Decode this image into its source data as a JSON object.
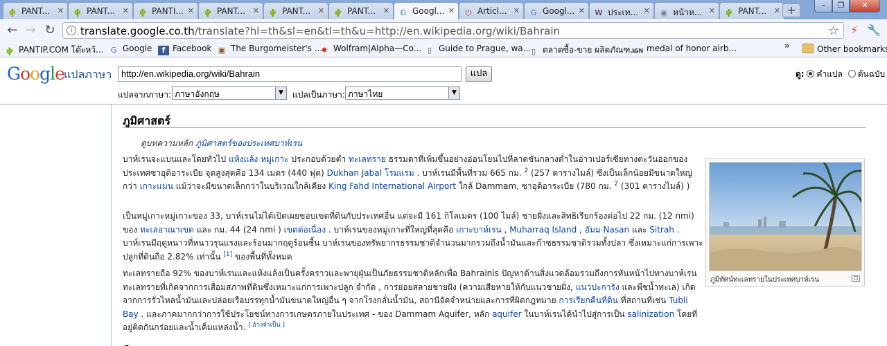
{
  "tabs": [
    {
      "label": "PANT...",
      "icon": "cactus-icon",
      "active": false
    },
    {
      "label": "PANT...",
      "icon": "cactus-icon",
      "active": false
    },
    {
      "label": "PANTI...",
      "icon": "cactus-icon",
      "active": false
    },
    {
      "label": "PANT...",
      "icon": "cactus-icon",
      "active": false
    },
    {
      "label": "PANT...",
      "icon": "cactus-icon",
      "active": false
    },
    {
      "label": "PANT...",
      "icon": "cactus-icon",
      "active": false
    },
    {
      "label": "Googl...",
      "icon": "google-translate-icon",
      "active": true
    },
    {
      "label": "Articl...",
      "icon": "power-icon",
      "active": false
    },
    {
      "label": "Googl...",
      "icon": "google-translate-icon",
      "active": false
    },
    {
      "label": "ประเท...",
      "icon": "wikipedia-icon",
      "active": false
    },
    {
      "label": "หน้าห...",
      "icon": "globe-icon",
      "active": false
    },
    {
      "label": "PANT...",
      "icon": "cactus-icon",
      "active": false
    }
  ],
  "toolbar": {
    "url_host": "translate.google.co.th",
    "url_rest": "/translate?hl=th&sl=en&tl=th&u=http://en.wikipedia.org/wiki/Bahrain"
  },
  "bookmarks": [
    {
      "label": "PANTIP.COM โต๊ะหว้...",
      "icon": "cactus-icon"
    },
    {
      "label": "Google",
      "icon": "google-icon"
    },
    {
      "label": "Facebook",
      "icon": "facebook-icon"
    },
    {
      "label": "The Burgomeister's ...",
      "icon": "burgomeister-icon"
    },
    {
      "label": "Wolfram|Alpha—Co...",
      "icon": "wolfram-icon"
    },
    {
      "label": "Guide to Prague, wa...",
      "icon": "page-icon"
    },
    {
      "label": "ตลาดซื้อ-ขาย ผลิตภัณฑ...",
      "icon": "page-icon"
    },
    {
      "label": "medal of honor airb...",
      "icon": "ign-icon"
    }
  ],
  "other_bookmarks": "Other bookmarks",
  "translate": {
    "logo_letters": [
      "G",
      "o",
      "o",
      "g",
      "l",
      "e"
    ],
    "product": "แปลภาษา",
    "url_value": "http://en.wikipedia.org/wiki/Bahrain",
    "go_label": "แปล",
    "from_label": "แปลจากภาษา:",
    "from_value": "ภาษาอังกฤษ",
    "to_label": "แปลเป็นภาษา:",
    "to_value": "ภาษาไทย",
    "view_label": "ดู:",
    "view_translation": "คำแปล",
    "view_original": "ต้นฉบับ"
  },
  "article": {
    "section_title": "ภูมิศาสตร์",
    "main_article_prefix": "ดูบทความหลัก",
    "main_article_link": "ภูมิศาสตร์ของประเทศบาห์เรน",
    "p1": [
      {
        "t": "บาห์เรนจะแบนและโดยทั่วไป "
      },
      {
        "a": "แห้งแล้ง หมู่เกาะ"
      },
      {
        "t": " ประกอบด้วยต่ำ "
      },
      {
        "a": "ทะเลทราย"
      },
      {
        "t": " ธรรมดาที่เพิ่มขึ้นอย่างอ่อนโยนไปที่ลาดชันกลางต่ำในอ่าวเปอร์เซียทางตะวันออกของประเทศซาอุดิอาระเบีย จุดสูงสุดคือ 134 เมตร (440 ฟุต) "
      },
      {
        "a": "Dukhan Jabal โรมแรม"
      },
      {
        "t": " . บาห์เรนมีพื้นที่รวม 665 กม. "
      },
      {
        "s": "2"
      },
      {
        "t": " (257 ตารางไมล์) ซึ่งเป็นเล็กน้อยมีขนาดใหญ่กว่า "
      },
      {
        "a": "เกาะแมน"
      },
      {
        "t": " แม้ว่าจะมีขนาดเล็กกว่าในบริเวณใกล้เคียง "
      },
      {
        "a": "King Fahd International Airport"
      },
      {
        "t": " ใกล้ Dammam, ซาอุดิอาระเบีย (780 กม. "
      },
      {
        "s": "2"
      },
      {
        "t": " (301 ตารางไมล์) )"
      }
    ],
    "p2": [
      {
        "t": "เป็นหมู่เกาะหมู่เกาะของ 33, บาห์เรนไม่ได้เปิดเผยขอบเขตที่ดินกับประเทศอื่น แต่จะมี 161 กิโลเมตร (100 ไมล์) ชายฝั่งและสิทธิเรียกร้องต่อไป 22 กม. (12 nmi) ของ "
      },
      {
        "a": "ทะเลอาณาเขต"
      },
      {
        "t": " และ กม. 44 (24 nmi ) "
      },
      {
        "a": "เขตต่อเนื่อง"
      },
      {
        "t": " . บาห์เรนของหมู่เกาะที่ใหญ่ที่สุดคือ "
      },
      {
        "a": "เกาะบาห์เรน"
      },
      {
        "t": " , "
      },
      {
        "a": "Muharraq Island"
      },
      {
        "t": " , "
      },
      {
        "a": "อัมม Nasan"
      },
      {
        "t": " และ "
      },
      {
        "a": "Sitrah"
      },
      {
        "t": " . บาห์เรนมีฤดูหนาวที่หนาวรุนแรงและร้อนมากฤดูร้อนชื้น บาห์เรนของทรัพยากรธรรมชาติจำนวนมากรวมถึงน้ำมันและก๊าซธรรมชาติรวมทั้งปลา ซึ่งเหมาะแก่การเพาะปลูกที่ดินถือ 2.82% เท่านั้น "
      },
      {
        "r": "[1]"
      },
      {
        "t": " ของพื้นที่ทั้งหมด"
      }
    ],
    "p3": [
      {
        "t": "ทะเลทรายถือ 92% ของบาห์เรนและแห้งแล้งเป็นครั้งคราวและพายุฝุ่นเป็นภัยธรรมชาติหลักเพื่อ Bahrainis ปัญหาด้านสิ่งแวดล้อมรวมถึงการหันหน้าไปทางบาห์เรนทะเลทรายที่เกิดจากการเสื่อมสภาพที่ดินซึ่งเหมาะแก่การเพาะปลูก จำกัด , การย่อยสลายชายฝั่ง (ความเสียหายให้กับแนวชายฝั่ง, "
      },
      {
        "a": "แนวปะการัง"
      },
      {
        "t": " และพืชน้ำทะเล) เกิดจากการรั่วไหลน้ำมันและปล่อยเรือบรรทุกน้ำมันขนาดใหญ่อื่น ๆ จากโรงกลั่นน้ำมัน, สถานีจัดจำหน่ายและการที่ผิดกฎหมาย "
      },
      {
        "a": "การเรียกคืนที่ดิน"
      },
      {
        "t": " ที่สถานที่เช่น "
      },
      {
        "a": "Tubli Bay"
      },
      {
        "t": " . และภาคมากกว่าการใช้ประโยชน์ทางการเกษตรภายในประเทศ - ของ Dammam Aquifer, หลัก "
      },
      {
        "a": "aquifer"
      },
      {
        "t": " ในบาห์เรนได้นำไปสู่การเป็น "
      },
      {
        "a": "salinization"
      },
      {
        "t": " โดยที่อยู่ติดกันกร่อยและน้ำเค็มแหล่งน้ำ. "
      },
      {
        "r": "[ อ้างจำเป็น ]"
      }
    ],
    "thumb_caption": "ภูมิทัศน์ทะเลทรายในประเทศบาห์เรน",
    "next_heading": "ภู"
  },
  "colors": {
    "link": "#0645ad",
    "tabbar": "#86a9da"
  }
}
